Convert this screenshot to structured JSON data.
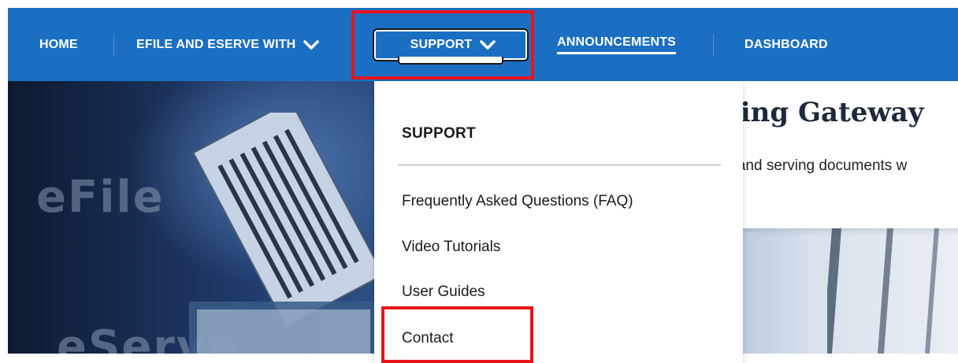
{
  "nav": {
    "home": "HOME",
    "efile": "EFILE AND ESERVE WITH",
    "support": "SUPPORT",
    "announcements": "ANNOUNCEMENTS",
    "dashboard": "DASHBOARD"
  },
  "hero": {
    "word_efile": "eFile",
    "word_eserve": "eServe",
    "heading": "ving Gateway",
    "subtitle": "g and serving documents w"
  },
  "dropdown": {
    "title": "SUPPORT",
    "items": [
      {
        "label": "Frequently Asked Questions (FAQ)"
      },
      {
        "label": "Video Tutorials"
      },
      {
        "label": "User Guides"
      },
      {
        "label": "Contact"
      }
    ]
  },
  "colors": {
    "nav_bg": "#1b6fc2",
    "highlight": "#e8141c",
    "accent": "#1fa3d6"
  },
  "icons": [
    "chevron-down-icon"
  ]
}
